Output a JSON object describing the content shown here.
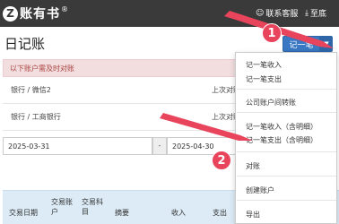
{
  "app": {
    "logo_mark": "Z",
    "name": "账有书",
    "reg": "®"
  },
  "top_links": {
    "service": "联系客服",
    "bottom": "至底"
  },
  "page": {
    "title": "日记账"
  },
  "new_button": {
    "label": "记一笔"
  },
  "alert": {
    "text": "以下账户需及时对账"
  },
  "accounts": [
    {
      "name": "银行 / 微信2",
      "recon": "上次对账"
    },
    {
      "name": "银行 / 工商银行",
      "recon": "上次对账"
    }
  ],
  "date_range": {
    "start": "2025-03-31",
    "separator": "-",
    "end": "2025-04-30"
  },
  "table_headers": [
    "交易日期",
    "交易账户",
    "交易科目",
    "摘要",
    "收入",
    "支出"
  ],
  "dropdown": {
    "items": [
      "记一笔收入",
      "记一笔支出",
      "公司账户间转账",
      "记一笔收入（含明细）",
      "记一笔支出（含明细）",
      "对账",
      "创建账户",
      "导出"
    ]
  },
  "annotations": {
    "step1": "1",
    "step2": "2"
  },
  "colors": {
    "topbar": "#3a3a3a",
    "primary": "#3a78c3",
    "alert_bg": "#f2dede",
    "alert_text": "#a94442",
    "header_bg": "#dcebf6",
    "annotation": "#e8455d"
  }
}
